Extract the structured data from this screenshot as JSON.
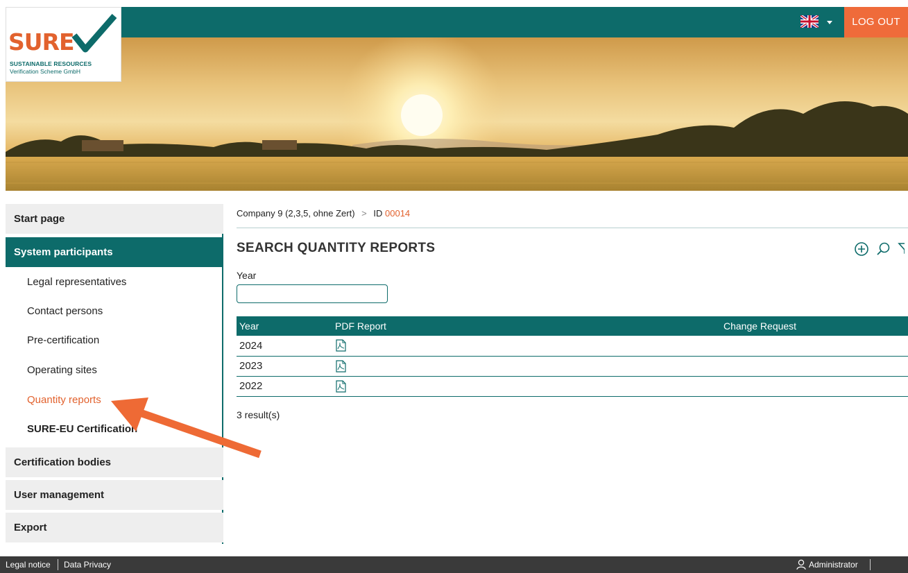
{
  "header": {
    "logout_label": "LOG OUT",
    "language_flag": "uk-flag-icon",
    "logo": {
      "word": "SURE",
      "line1": "SUSTAINABLE RESOURCES",
      "line2": "Verification Scheme GmbH"
    }
  },
  "sidebar": {
    "items": [
      {
        "label": "Start page"
      },
      {
        "label": "System participants"
      },
      {
        "label": "Legal representatives"
      },
      {
        "label": "Contact persons"
      },
      {
        "label": "Pre-certification"
      },
      {
        "label": "Operating sites"
      },
      {
        "label": "Quantity reports"
      },
      {
        "label": "SURE-EU Certification"
      },
      {
        "label": "Certification bodies"
      },
      {
        "label": "User management"
      },
      {
        "label": "Export"
      }
    ]
  },
  "main": {
    "breadcrumb": {
      "company": "Company 9 (2,3,5, ohne Zert)",
      "separator": ">",
      "id_label": "ID",
      "id_value": "00014"
    },
    "title": "SEARCH QUANTITY REPORTS",
    "year_field_label": "Year",
    "year_field_value": "",
    "table": {
      "headers": [
        "Year",
        "PDF Report",
        "Change Request"
      ],
      "rows": [
        {
          "year": "2024",
          "change_request": ""
        },
        {
          "year": "2023",
          "change_request": ""
        },
        {
          "year": "2022",
          "change_request": ""
        }
      ]
    },
    "result_count": "3 result(s)"
  },
  "footer": {
    "legal_notice": "Legal notice",
    "data_privacy": "Data Privacy",
    "user": "Administrator"
  },
  "colors": {
    "brand_teal": "#0d6b6a",
    "accent_orange": "#ef6b3a",
    "selected_text": "#e2622e",
    "footer_bg": "#3a3a3a"
  }
}
